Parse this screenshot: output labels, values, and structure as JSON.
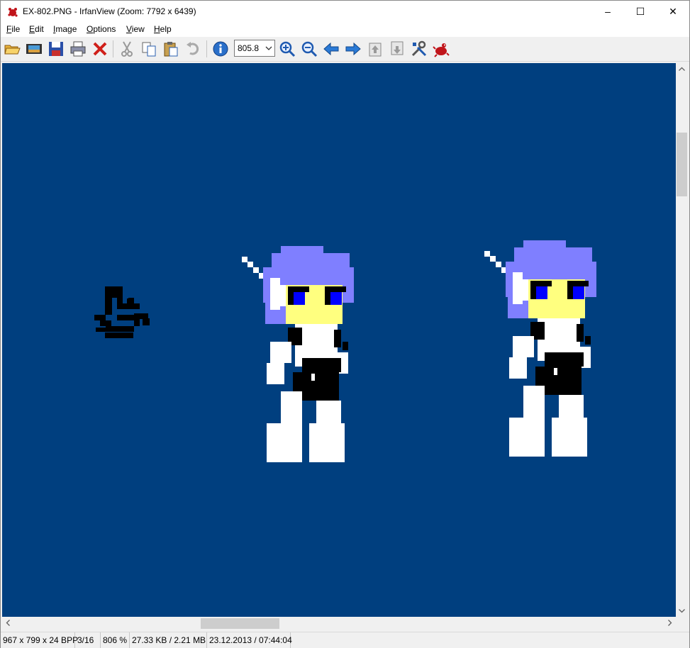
{
  "window": {
    "title": "EX-802.PNG - IrfanView (Zoom: 7792 x 6439)",
    "controls": {
      "minimize": "–",
      "maximize": "☐",
      "close": "✕"
    }
  },
  "menu": [
    {
      "first": "F",
      "rest": "ile"
    },
    {
      "first": "E",
      "rest": "dit"
    },
    {
      "first": "I",
      "rest": "mage"
    },
    {
      "first": "O",
      "rest": "ptions"
    },
    {
      "first": "V",
      "rest": "iew"
    },
    {
      "first": "H",
      "rest": "elp"
    }
  ],
  "toolbar": {
    "zoom_value": "805.8",
    "icons": [
      "open-icon",
      "slideshow-icon",
      "save-icon",
      "print-icon",
      "delete-icon",
      "cut-icon",
      "copy-icon",
      "paste-icon",
      "undo-icon",
      "info-icon",
      "zoom-in-icon",
      "zoom-out-icon",
      "previous-icon",
      "next-icon",
      "first-page-icon",
      "last-page-icon",
      "settings-icon",
      "irfanview-icon"
    ]
  },
  "canvas": {
    "background": "#003f7f"
  },
  "status": {
    "dimensions": "967 x 799 x 24 BPP",
    "page": "3/16",
    "zoom": "806 %",
    "size": "27.33 KB / 2.21 MB",
    "datetime": "23.12.2013 / 07:44:04"
  },
  "colors": {
    "hair": "#7f7fff",
    "skin": "#ffff7f",
    "eye": "#0000ff",
    "suit": "#ffffff",
    "dark": "#000000"
  }
}
